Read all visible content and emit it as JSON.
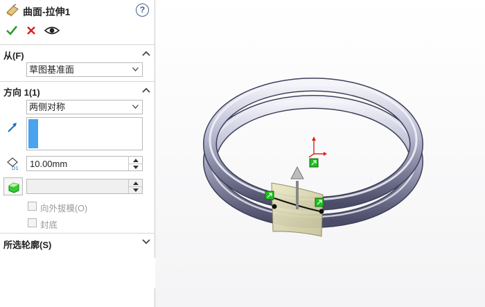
{
  "feature": {
    "title": "曲面-拉伸1",
    "help_label": "?"
  },
  "actions": [
    {
      "name": "ok-checkmark-icon",
      "color": "#2f9a2f"
    },
    {
      "name": "cancel-x-icon",
      "color": "#d32020"
    },
    {
      "name": "preview-eye-icon",
      "color": "#222222"
    }
  ],
  "from_section": {
    "heading": "从(F)",
    "start_condition": "草图基准面"
  },
  "direction1": {
    "heading": "方向 1(1)",
    "end_condition": "两侧对称",
    "depth": "10.00mm",
    "draft_outward_label": "向外拔模(O)",
    "cap_end_label": "封底"
  },
  "selected_contours": {
    "heading": "所选轮廓(S)"
  },
  "colors": {
    "selection_strip": "#4aa3ee",
    "ring_body": "#a7a9c2",
    "surface_preview": "#d9d6b0",
    "handle_green": "#1fbf1f",
    "triad_red": "#e02020"
  }
}
